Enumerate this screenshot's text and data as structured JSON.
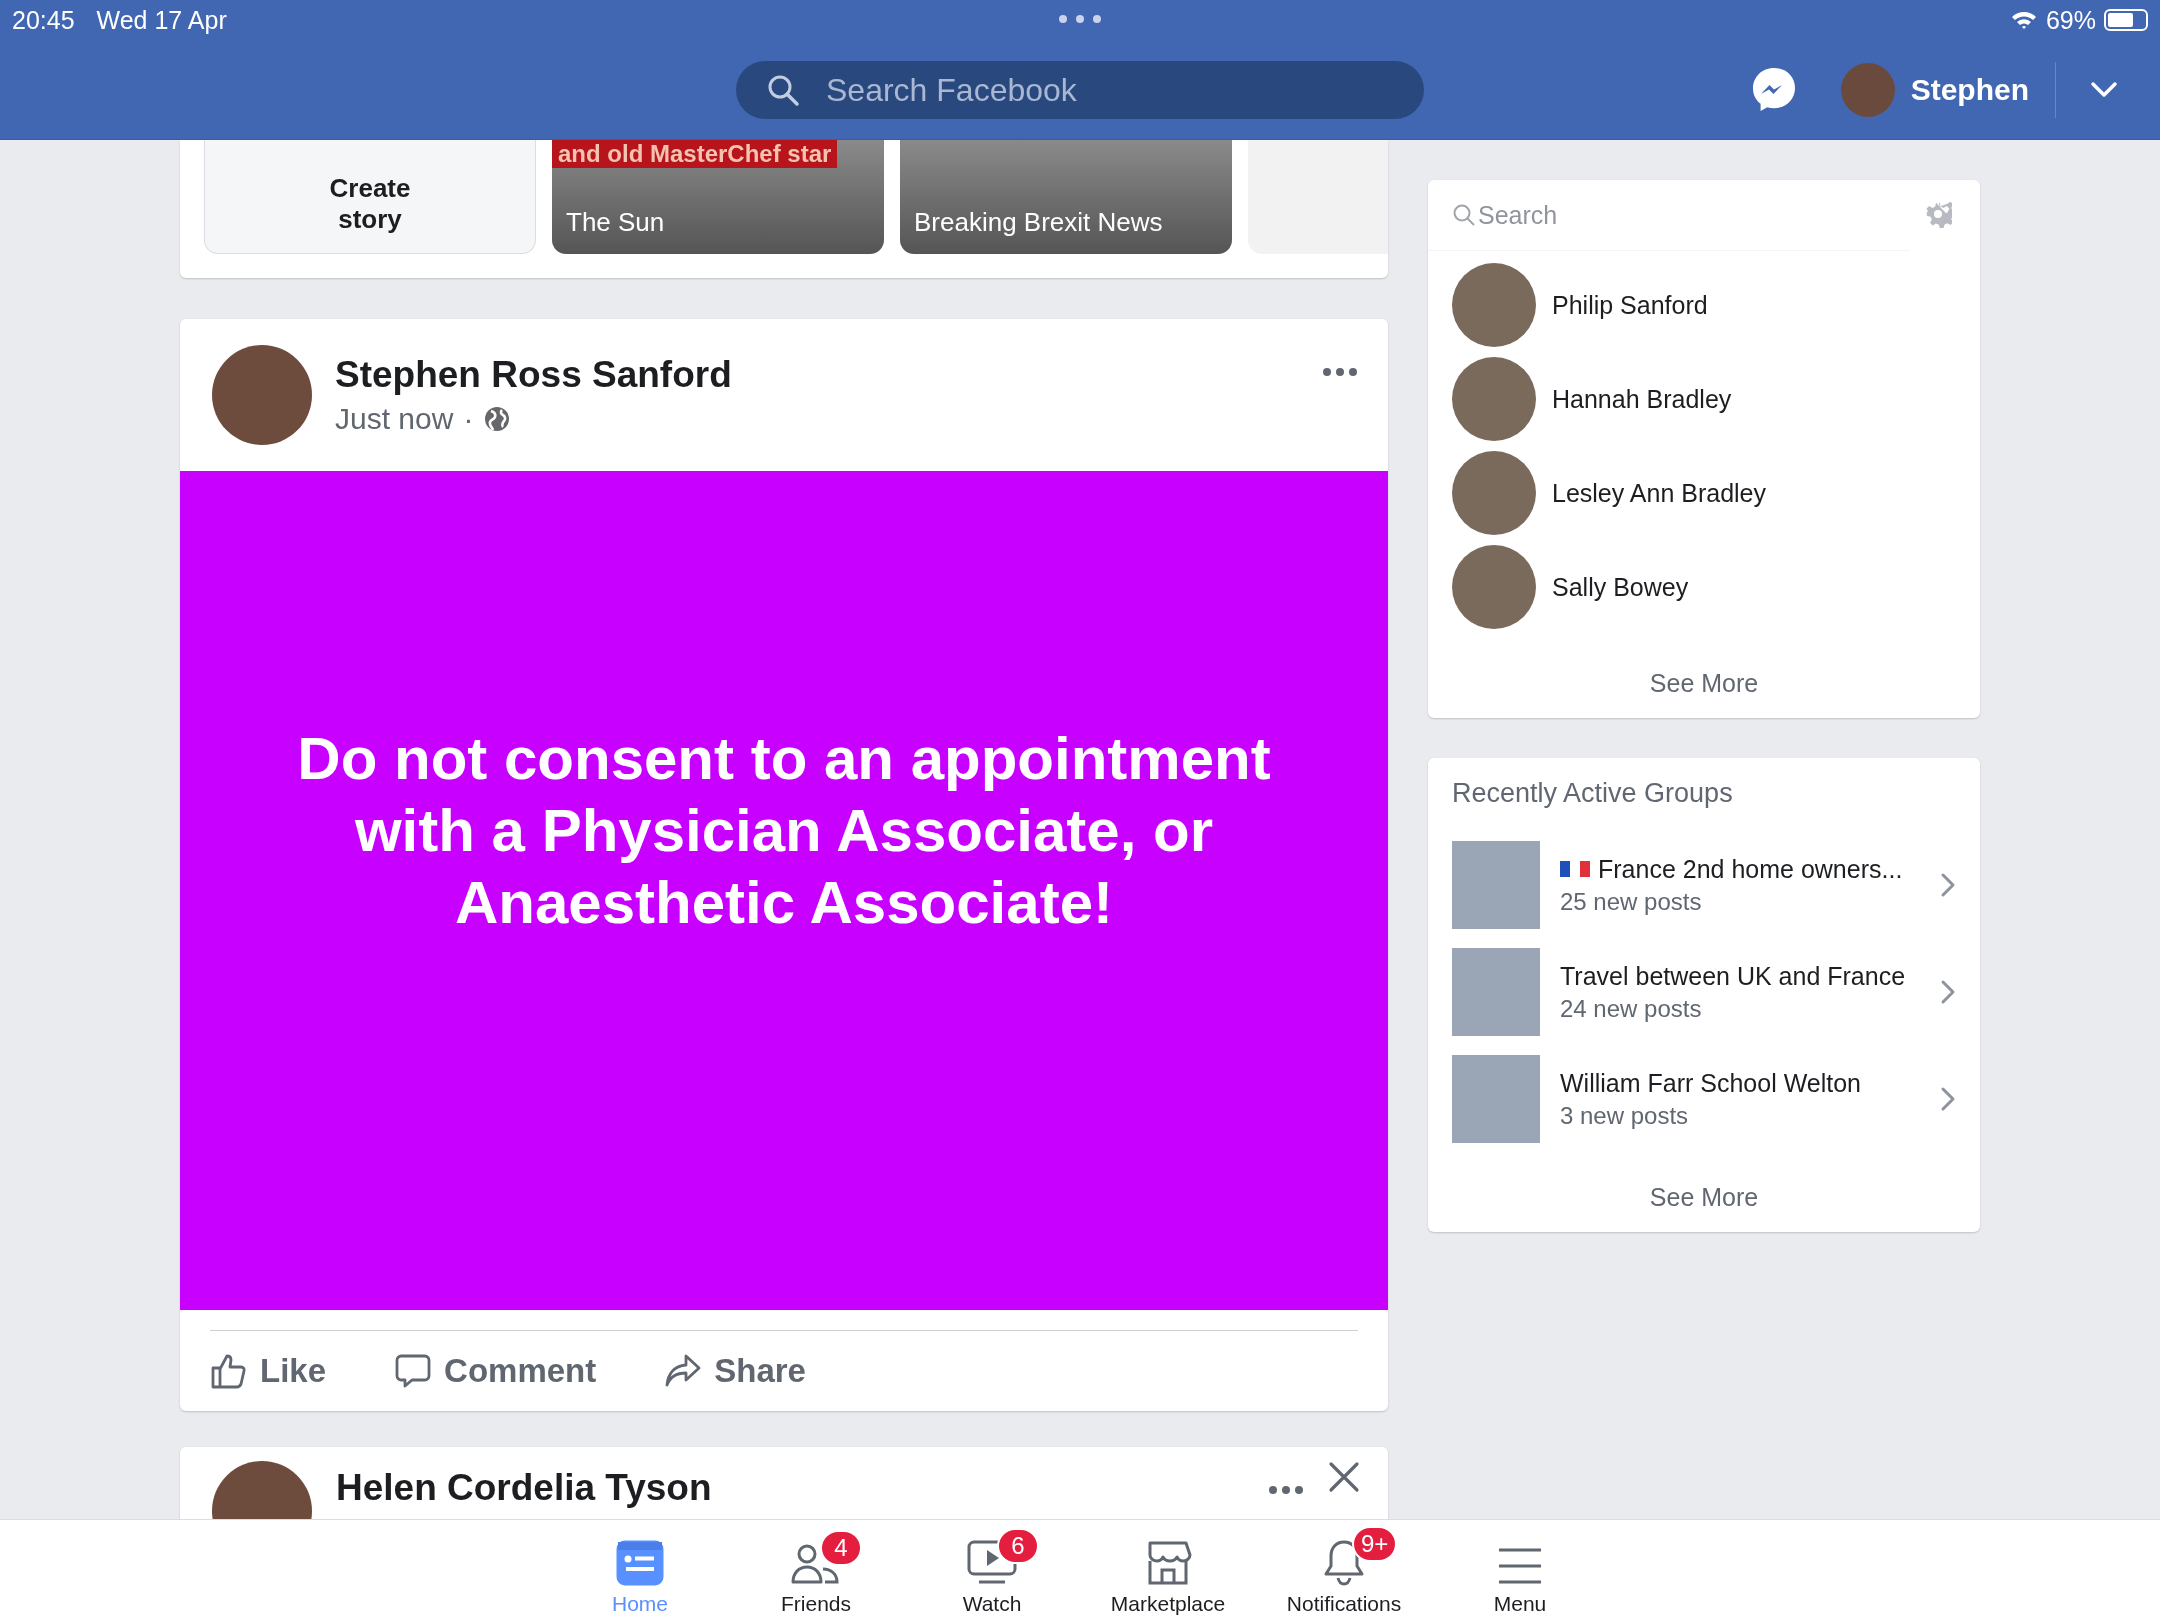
{
  "status_bar": {
    "time": "20:45",
    "date": "Wed 17 Apr",
    "battery": "69%"
  },
  "top_bar": {
    "search_placeholder": "Search Facebook",
    "user": "Stephen"
  },
  "stories": [
    {
      "kind": "create",
      "label": "Create story"
    },
    {
      "kind": "story",
      "label": "The Sun",
      "caption": "and old  MasterChef star"
    },
    {
      "kind": "story",
      "label": "Breaking Brexit News"
    },
    {
      "kind": "partial"
    }
  ],
  "post": {
    "author": "Stephen Ross Sanford",
    "time": "Just now",
    "separator": "·",
    "text": "Do not consent to an appointment with a Physician Associate, or Anaesthetic Associate!",
    "actions": [
      {
        "kind": "like",
        "label": "Like"
      },
      {
        "kind": "comment",
        "label": "Comment"
      },
      {
        "kind": "share",
        "label": "Share"
      }
    ]
  },
  "next_post": {
    "author": "Helen Cordelia Tyson"
  },
  "contacts": {
    "search_placeholder": "Search",
    "items": [
      {
        "name": "Philip Sanford"
      },
      {
        "name": "Hannah Bradley"
      },
      {
        "name": "Lesley Ann Bradley"
      },
      {
        "name": "Sally Bowey"
      }
    ],
    "see_more": "See More"
  },
  "groups": {
    "title": "Recently Active Groups",
    "items": [
      {
        "name": "France 2nd home owners...",
        "posts": "25 new posts",
        "flag": true
      },
      {
        "name": "Travel between UK and France",
        "posts": "24 new posts",
        "flag": false
      },
      {
        "name": "William Farr School Welton",
        "posts": "3 new posts",
        "flag": false
      }
    ],
    "see_more": "See More"
  },
  "bottom_nav": [
    {
      "kind": "home",
      "label": "Home",
      "selected": true
    },
    {
      "kind": "friends",
      "label": "Friends",
      "badge": "4",
      "selected": false
    },
    {
      "kind": "watch",
      "label": "Watch",
      "badge": "6",
      "selected": false
    },
    {
      "kind": "marketplace",
      "label": "Marketplace",
      "selected": false
    },
    {
      "kind": "notifications",
      "label": "Notifications",
      "badge": "9+",
      "selected": false
    },
    {
      "kind": "menu",
      "label": "Menu",
      "selected": false
    }
  ]
}
